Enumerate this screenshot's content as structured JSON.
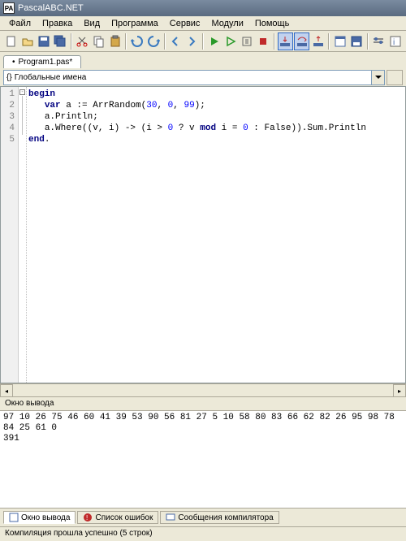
{
  "window": {
    "title": "PascalABC.NET"
  },
  "menu": {
    "file": "Файл",
    "edit": "Правка",
    "view": "Вид",
    "program": "Программа",
    "service": "Сервис",
    "modules": "Модули",
    "help": "Помощь"
  },
  "tab": {
    "name": "Program1.pas*",
    "bullet": "•"
  },
  "combo": {
    "label": "Глобальные имена"
  },
  "code": {
    "lines": [
      "1",
      "2",
      "3",
      "4",
      "5"
    ],
    "l1_kw": "begin",
    "l2_kw": "var",
    "l2_a": " a := ArrRandom(",
    "l2_n1": "30",
    "l2_c1": ", ",
    "l2_n2": "0",
    "l2_c2": ", ",
    "l2_n3": "99",
    "l2_e": ");",
    "l3": "a.Println;",
    "l4_a": "a.Where((v, i) -> (i > ",
    "l4_n1": "0",
    "l4_b": " ? v ",
    "l4_kw": "mod",
    "l4_c": " i = ",
    "l4_n2": "0",
    "l4_d": " : False)).Sum.Println",
    "l5_kw": "end",
    "l5_dot": "."
  },
  "output": {
    "title": "Окно вывода",
    "line1": "97 10 26 75 46 60 41 39 53 90 56 81 27 5 10 58 80 83 66 62 82 26 95 98 78 84 25 61 0",
    "line2": "391"
  },
  "bottom_tabs": {
    "t1": "Окно вывода",
    "t2": "Список ошибок",
    "t3": "Сообщения компилятора"
  },
  "status": {
    "text": "Компиляция прошла успешно (5 строк)"
  }
}
